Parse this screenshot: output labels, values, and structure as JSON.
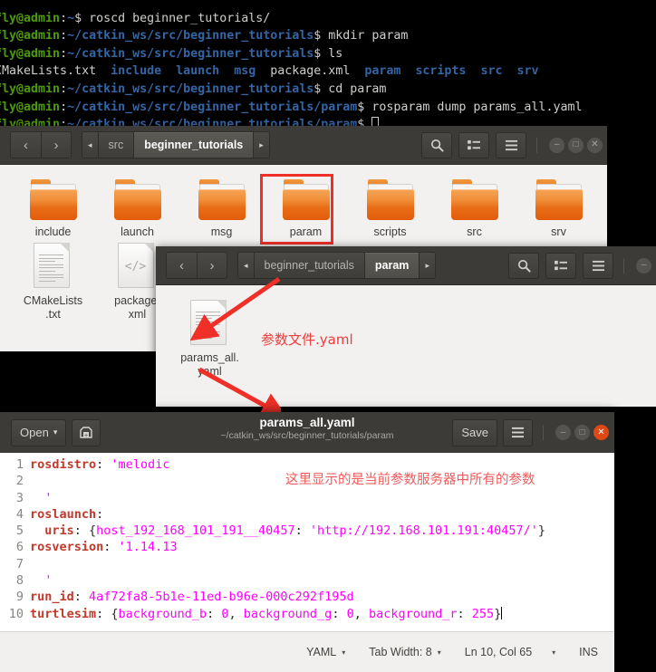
{
  "terminal": {
    "lines": [
      {
        "prompt": "fly@admin",
        "sep": ":",
        "path": "~",
        "dollar": "$ ",
        "cmd": "roscd beginner_tutorials/",
        "type": "cmd"
      },
      {
        "prompt": "fly@admin",
        "sep": ":",
        "path": "~/catkin_ws/src/beginner_tutorials",
        "dollar": "$ ",
        "cmd": "mkdir param",
        "type": "cmd"
      },
      {
        "prompt": "fly@admin",
        "sep": ":",
        "path": "~/catkin_ws/src/beginner_tutorials",
        "dollar": "$ ",
        "cmd": "ls",
        "type": "cmd"
      },
      {
        "type": "ls",
        "items": [
          {
            "text": "CMakeLists.txt",
            "kind": "file"
          },
          {
            "text": "include",
            "kind": "dir"
          },
          {
            "text": "launch",
            "kind": "dir"
          },
          {
            "text": "msg",
            "kind": "dir"
          },
          {
            "text": "package.xml",
            "kind": "file"
          },
          {
            "text": "param",
            "kind": "dir"
          },
          {
            "text": "scripts",
            "kind": "dir"
          },
          {
            "text": "src",
            "kind": "dir"
          },
          {
            "text": "srv",
            "kind": "dir"
          }
        ]
      },
      {
        "prompt": "fly@admin",
        "sep": ":",
        "path": "~/catkin_ws/src/beginner_tutorials",
        "dollar": "$ ",
        "cmd": "cd param",
        "type": "cmd"
      },
      {
        "prompt": "fly@admin",
        "sep": ":",
        "path": "~/catkin_ws/src/beginner_tutorials/param",
        "dollar": "$ ",
        "cmd": "rosparam dump params_all.yaml",
        "type": "cmd"
      },
      {
        "prompt": "fly@admin",
        "sep": ":",
        "path": "~/catkin_ws/src/beginner_tutorials/param",
        "dollar": "$ ",
        "cmd": "",
        "type": "cursor"
      }
    ]
  },
  "file_manager_1": {
    "back_label": "‹",
    "forward_label": "›",
    "crumb_prev": "◂",
    "crumbs": [
      {
        "label": "src",
        "active": false
      },
      {
        "label": "beginner_tutorials",
        "active": true
      }
    ],
    "crumb_next": "▸",
    "search_icon": "search-icon",
    "view_icon": "list-view-icon",
    "menu_icon": "hamburger-menu-icon",
    "window_controls": [
      "minimize",
      "maximize",
      "close"
    ],
    "items": [
      {
        "label": "include",
        "type": "folder",
        "highlighted": false
      },
      {
        "label": "launch",
        "type": "folder",
        "highlighted": false
      },
      {
        "label": "msg",
        "type": "folder",
        "highlighted": false
      },
      {
        "label": "param",
        "type": "folder",
        "highlighted": true
      },
      {
        "label": "scripts",
        "type": "folder",
        "highlighted": false
      },
      {
        "label": "src",
        "type": "folder",
        "highlighted": false
      },
      {
        "label": "srv",
        "type": "folder",
        "highlighted": false
      },
      {
        "label": "CMakeLists.txt",
        "type": "doc",
        "highlighted": false
      },
      {
        "label": "package.xml",
        "type": "code",
        "highlighted": false
      }
    ]
  },
  "file_manager_2": {
    "back_label": "‹",
    "forward_label": "›",
    "crumb_prev": "◂",
    "crumbs": [
      {
        "label": "beginner_tutorials",
        "active": false
      },
      {
        "label": "param",
        "active": true
      }
    ],
    "crumb_next": "▸",
    "items": [
      {
        "label": "params_all.yaml",
        "type": "doc"
      }
    ]
  },
  "annotations": {
    "yaml_file_note": "参数文件.yaml",
    "editor_note": "这里显示的是当前参数服务器中所有的参数",
    "arrow_color": "#f03028"
  },
  "editor": {
    "open_label": "Open",
    "open_caret": "▾",
    "save_as_icon": "save-as-icon",
    "title": "params_all.yaml",
    "subtitle": "~/catkin_ws/src/beginner_tutorials/param",
    "save_label": "Save",
    "menu_icon": "hamburger-menu-icon",
    "lines": [
      {
        "n": "1",
        "segments": [
          {
            "t": "rosdistro",
            "c": "k"
          },
          {
            "t": ": ",
            "c": "p"
          },
          {
            "t": "'melodic",
            "c": "v"
          }
        ]
      },
      {
        "n": "2",
        "segments": []
      },
      {
        "n": "3",
        "segments": [
          {
            "t": "  '",
            "c": "v"
          }
        ]
      },
      {
        "n": "4",
        "segments": [
          {
            "t": "roslaunch",
            "c": "k"
          },
          {
            "t": ":",
            "c": "p"
          }
        ]
      },
      {
        "n": "5",
        "segments": [
          {
            "t": "  ",
            "c": "p"
          },
          {
            "t": "uris",
            "c": "k"
          },
          {
            "t": ": {",
            "c": "p"
          },
          {
            "t": "host_192_168_101_191__40457",
            "c": "v"
          },
          {
            "t": ": ",
            "c": "p"
          },
          {
            "t": "'http://192.168.101.191:40457/'",
            "c": "v"
          },
          {
            "t": "}",
            "c": "p"
          }
        ]
      },
      {
        "n": "6",
        "segments": [
          {
            "t": "rosversion",
            "c": "k"
          },
          {
            "t": ": ",
            "c": "p"
          },
          {
            "t": "'1.14.13",
            "c": "v"
          }
        ]
      },
      {
        "n": "7",
        "segments": []
      },
      {
        "n": "8",
        "segments": [
          {
            "t": "  '",
            "c": "v"
          }
        ]
      },
      {
        "n": "9",
        "segments": [
          {
            "t": "run_id",
            "c": "k"
          },
          {
            "t": ": ",
            "c": "p"
          },
          {
            "t": "4af72fa8-5b1e-11ed-b96e-000c292f195d",
            "c": "v"
          }
        ]
      },
      {
        "n": "10",
        "segments": [
          {
            "t": "turtlesim",
            "c": "k"
          },
          {
            "t": ": {",
            "c": "p"
          },
          {
            "t": "background_b",
            "c": "v"
          },
          {
            "t": ": ",
            "c": "p"
          },
          {
            "t": "0",
            "c": "v"
          },
          {
            "t": ", ",
            "c": "p"
          },
          {
            "t": "background_g",
            "c": "v"
          },
          {
            "t": ": ",
            "c": "p"
          },
          {
            "t": "0",
            "c": "v"
          },
          {
            "t": ", ",
            "c": "p"
          },
          {
            "t": "background_r",
            "c": "v"
          },
          {
            "t": ": ",
            "c": "p"
          },
          {
            "t": "255",
            "c": "v"
          },
          {
            "t": "}",
            "c": "p"
          }
        ],
        "caret": true
      }
    ],
    "status": {
      "language": "YAML",
      "tab_width": "Tab Width: 8",
      "position": "Ln 10, Col 65",
      "insert_mode": "INS",
      "caret": "▾"
    }
  },
  "colors": {
    "terminal_bg": "#000000",
    "prompt_green": "#4e9a06",
    "path_blue": "#3465a4",
    "folder_orange": "#e96d16",
    "highlight_red": "#f03028",
    "chrome_dark": "#3c3b37",
    "close_orange": "#dd4814",
    "yaml_key_red": "#c0392b",
    "yaml_value_magenta": "#ff00ff"
  }
}
